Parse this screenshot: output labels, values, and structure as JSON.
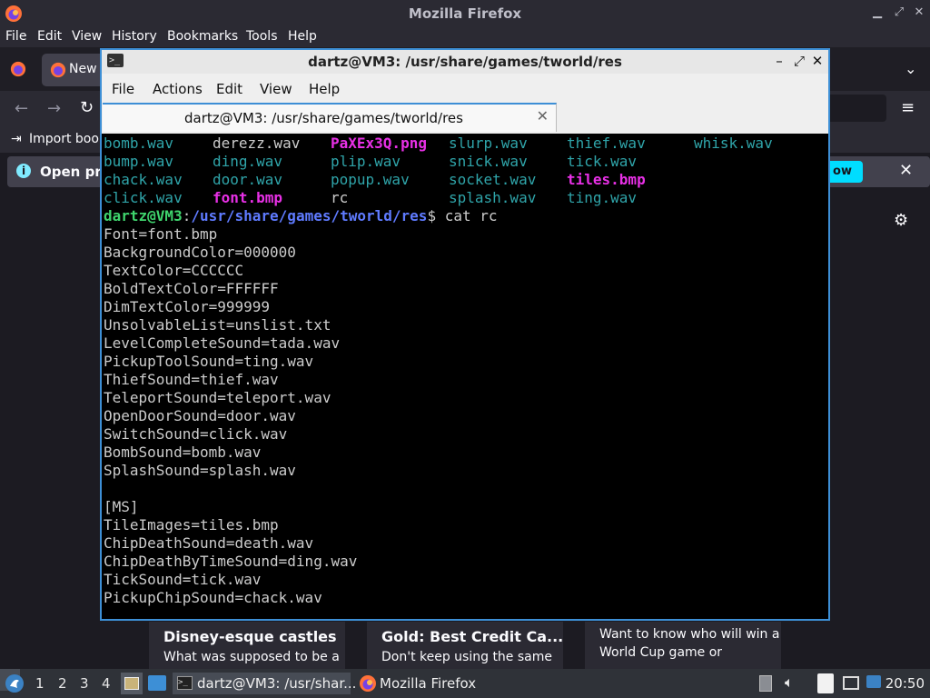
{
  "firefox": {
    "window_title": "Mozilla Firefox",
    "menus": [
      "File",
      "Edit",
      "View",
      "History",
      "Bookmarks",
      "Tools",
      "Help"
    ],
    "tab_label": "New",
    "bookmark_label": "Import book",
    "notification_text": "Open pre",
    "notification_button": "ow",
    "cards": [
      {
        "title": "Disney-esque castles",
        "subtitle": "What was supposed to be a"
      },
      {
        "title": "Gold: Best Credit Ca...",
        "subtitle": "Don't keep using the same"
      },
      {
        "title": "",
        "subtitle": "Want to know who will win a",
        "subtitle2": "World Cup game or"
      }
    ]
  },
  "terminal": {
    "window_title": "dartz@VM3: /usr/share/games/tworld/res",
    "menus": [
      "File",
      "Actions",
      "Edit",
      "View",
      "Help"
    ],
    "tab_label": "dartz@VM3: /usr/share/games/tworld/res",
    "ls_rows": [
      [
        "bomb.wav",
        "derezz.wav",
        "PaXEx3Q.png",
        "slurp.wav",
        "thief.wav",
        "whisk.wav"
      ],
      [
        "bump.wav",
        "ding.wav",
        "plip.wav",
        "snick.wav",
        "tick.wav",
        ""
      ],
      [
        "chack.wav",
        "door.wav",
        "popup.wav",
        "socket.wav",
        "tiles.bmp",
        ""
      ],
      [
        "click.wav",
        "font.bmp",
        "rc",
        "splash.wav",
        "ting.wav",
        ""
      ]
    ],
    "prompt_user": "dartz@VM3",
    "prompt_sep": ":",
    "prompt_path": "/usr/share/games/tworld/res",
    "prompt_cmd": "$ cat rc",
    "output_lines": [
      "Font=font.bmp",
      "BackgroundColor=000000",
      "TextColor=CCCCCC",
      "BoldTextColor=FFFFFF",
      "DimTextColor=999999",
      "UnsolvableList=unslist.txt",
      "LevelCompleteSound=tada.wav",
      "PickupToolSound=ting.wav",
      "ThiefSound=thief.wav",
      "TeleportSound=teleport.wav",
      "OpenDoorSound=door.wav",
      "SwitchSound=click.wav",
      "BombSound=bomb.wav",
      "SplashSound=splash.wav",
      "",
      "[MS]",
      "TileImages=tiles.bmp",
      "ChipDeathSound=death.wav",
      "ChipDeathByTimeSound=ding.wav",
      "TickSound=tick.wav",
      "PickupChipSound=chack.wav"
    ]
  },
  "taskbar": {
    "workspaces": [
      "1",
      "2",
      "3",
      "4"
    ],
    "task_terminal": "dartz@VM3: /usr/shar...",
    "task_firefox": "Mozilla Firefox",
    "clock": "20:50"
  },
  "colors": {
    "terminal_accent": "#3d8fd6",
    "wav_cyan": "#2fa4a9",
    "bold_magenta": "#e830e6",
    "prompt_green": "#3fd46d",
    "prompt_blue": "#5f7bff"
  }
}
